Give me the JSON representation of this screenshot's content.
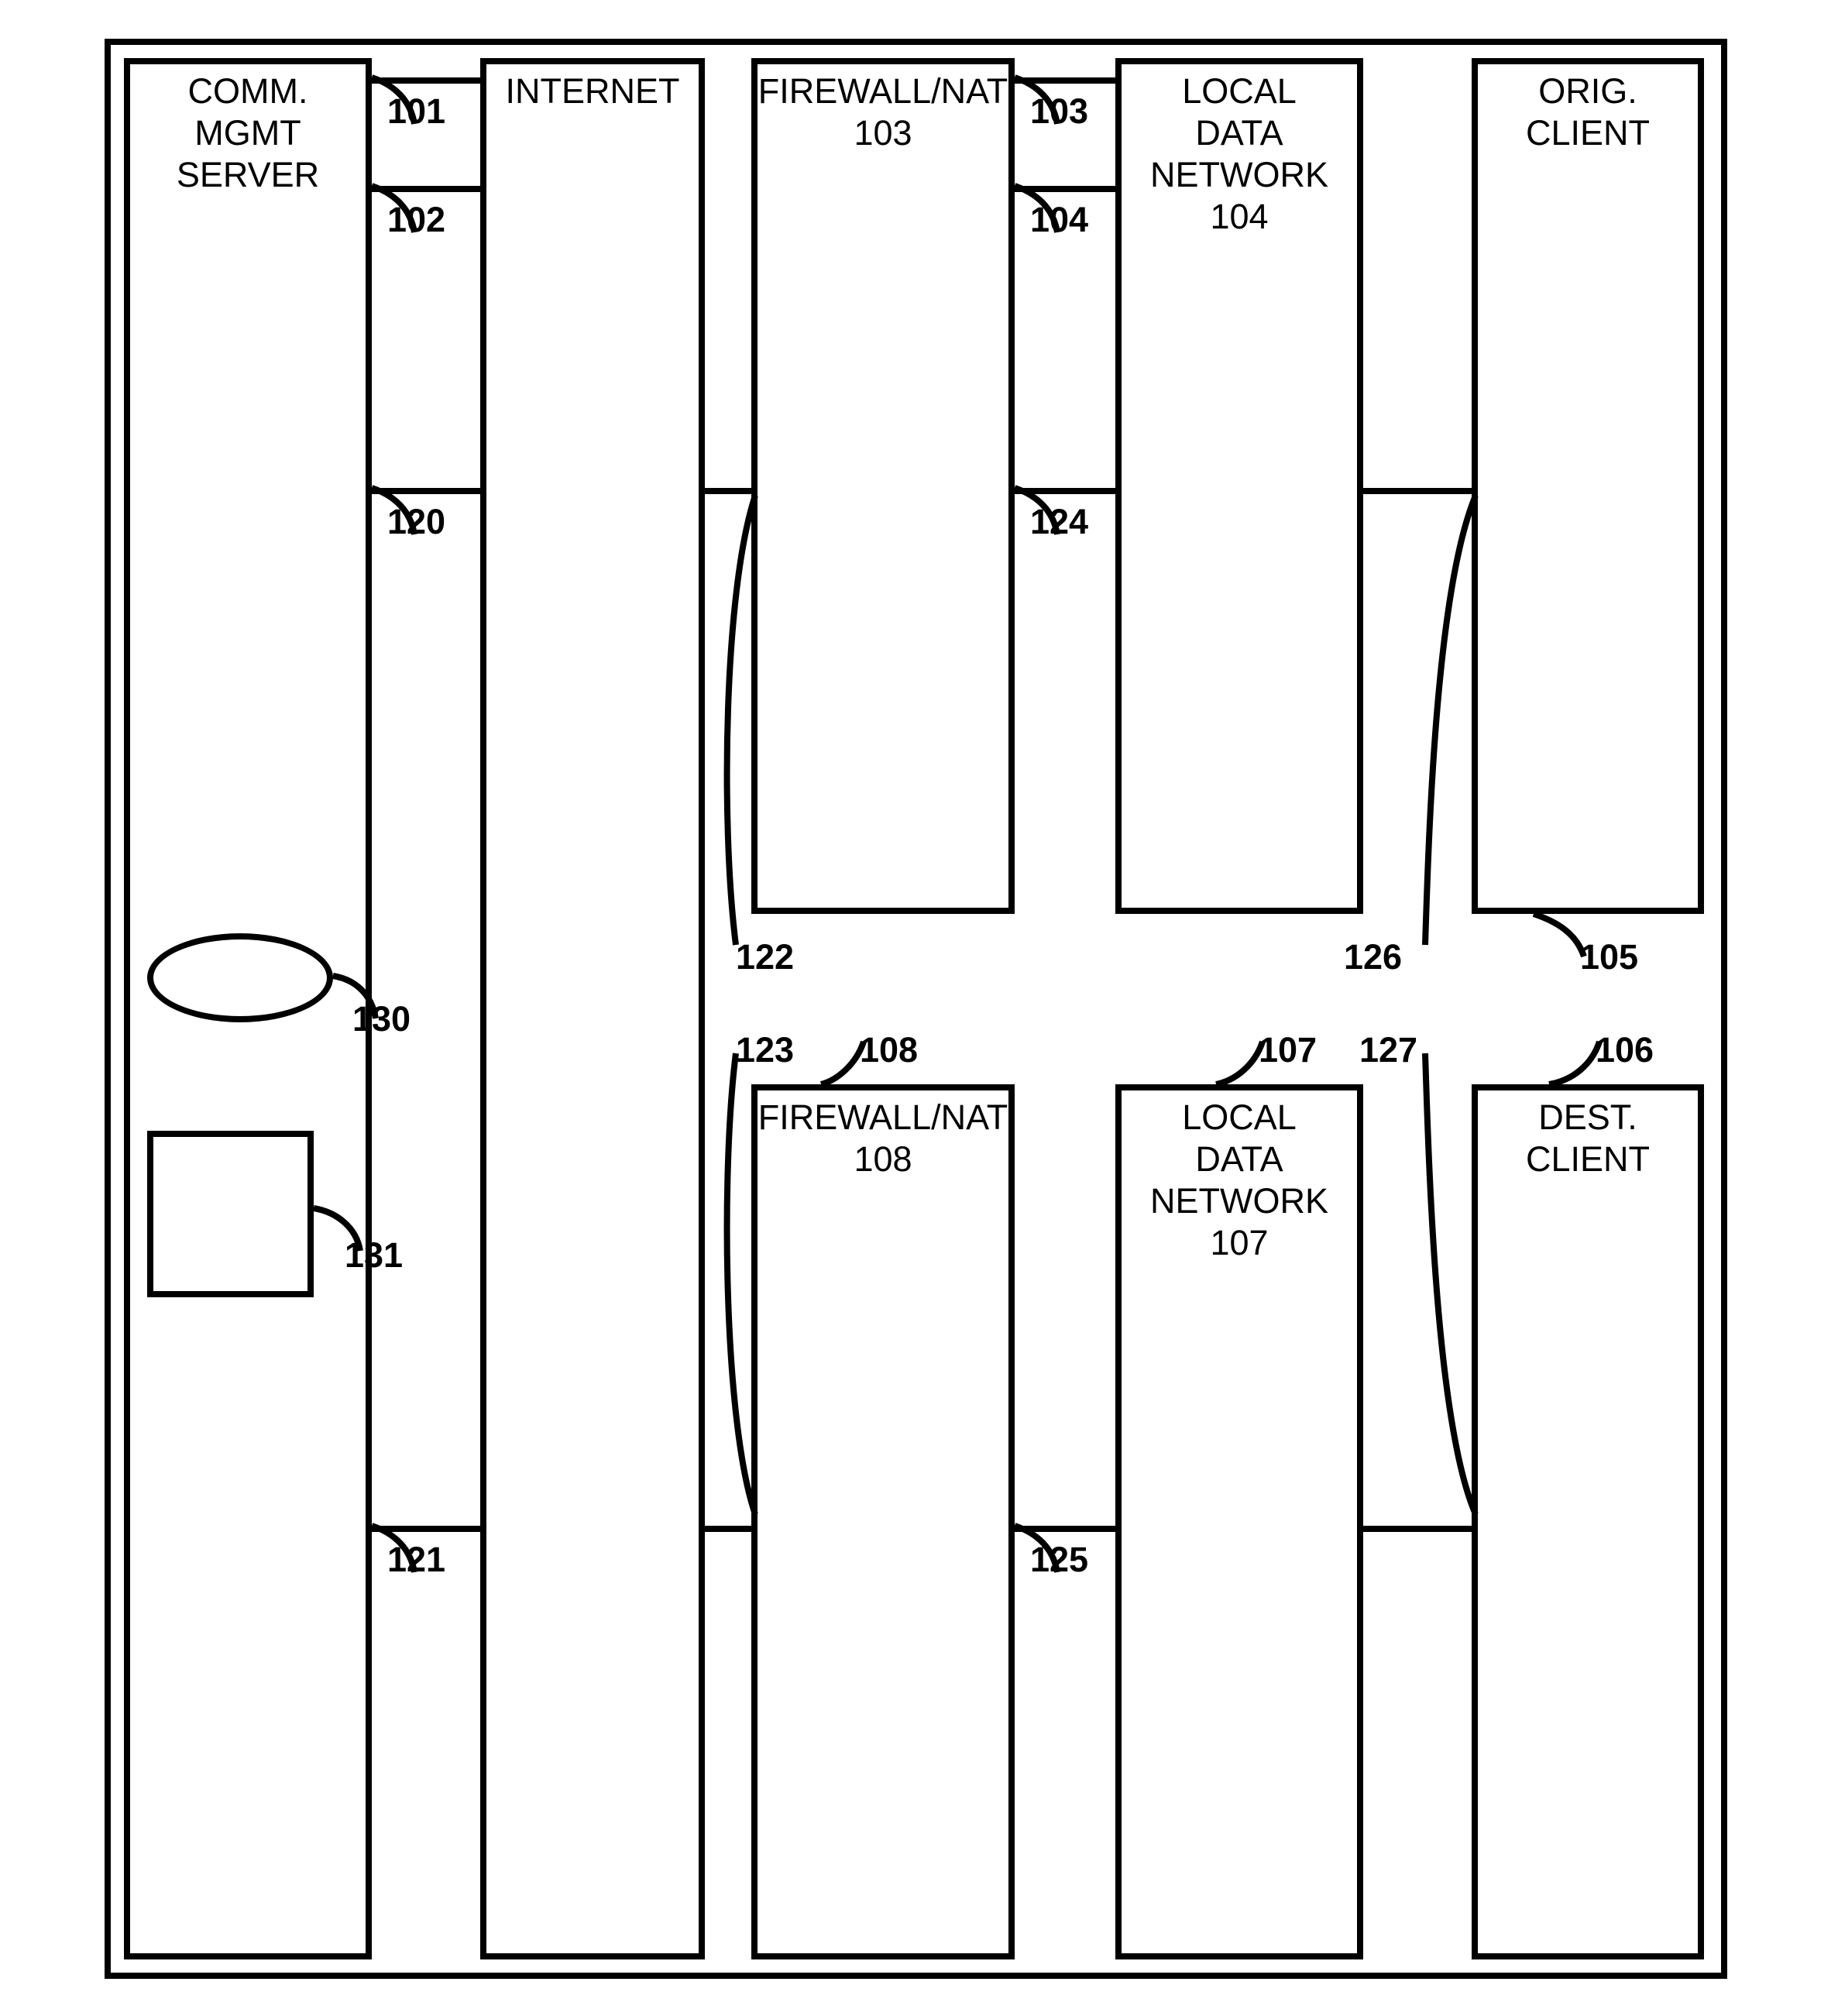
{
  "boxes": {
    "server": {
      "title": "COMM. MGMT\nSERVER"
    },
    "internet": {
      "title": "INTERNET"
    },
    "fw1": {
      "title": "FIREWALL/NAT\n103"
    },
    "ldn1": {
      "title": "LOCAL\nDATA\nNETWORK\n104"
    },
    "orig": {
      "title": "ORIG.\nCLIENT"
    },
    "fw2": {
      "title": "FIREWALL/NAT\n108"
    },
    "ldn2": {
      "title": "LOCAL\nDATA\nNETWORK\n107"
    },
    "dest": {
      "title": "DEST.\nCLIENT"
    }
  },
  "labels": {
    "l101": "101",
    "l102": "102",
    "l103": "103",
    "l104": "104",
    "l105": "105",
    "l106": "106",
    "l107": "107",
    "l108": "108",
    "l120": "120",
    "l121": "121",
    "l122": "122",
    "l123": "123",
    "l124": "124",
    "l125": "125",
    "l126": "126",
    "l127": "127",
    "l130": "130",
    "l131": "131"
  }
}
